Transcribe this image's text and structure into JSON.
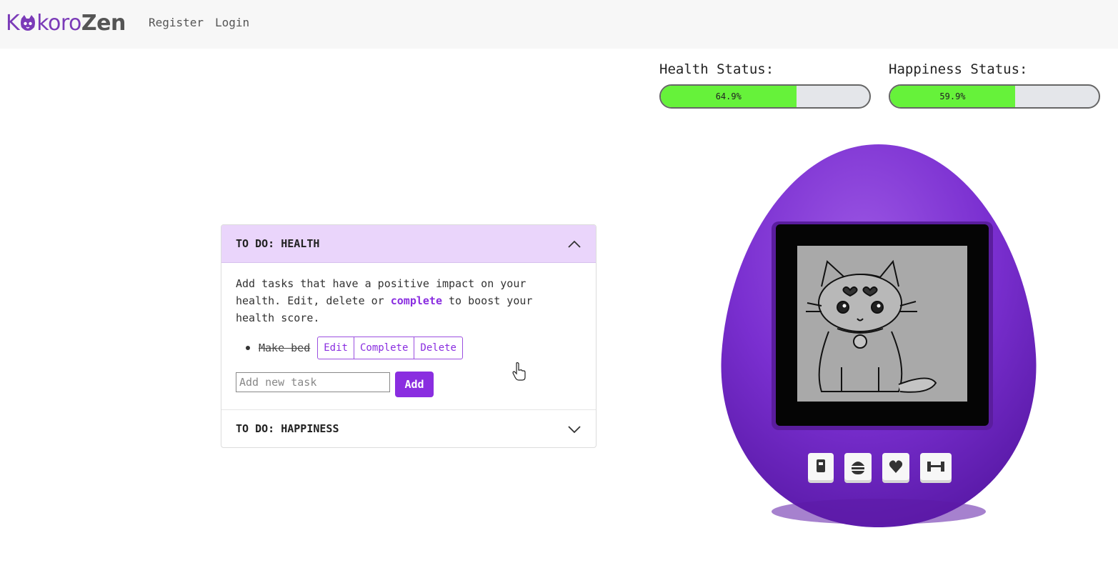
{
  "nav": {
    "logo_text_a": "K",
    "logo_text_b": "koro",
    "logo_text_c": "Zen",
    "register": "Register",
    "login": "Login"
  },
  "status": {
    "health_label": "Health Status:",
    "health_value": "64.9%",
    "health_fraction": 0.649,
    "happiness_label": "Happiness Status:",
    "happiness_value": "59.9%",
    "happiness_fraction": 0.599,
    "bar_color": "#66f23a"
  },
  "health_panel": {
    "title": "TO DO: HEALTH",
    "desc_a": "Add tasks that have a positive impact on your health. Edit, delete or ",
    "desc_highlight": "complete",
    "desc_b": " to boost your health score.",
    "tasks": [
      {
        "text": "Make bed",
        "completed": true,
        "edit": "Edit",
        "complete": "Complete",
        "delete": "Delete"
      }
    ],
    "input_placeholder": "Add new task",
    "add_label": "Add"
  },
  "happiness_panel": {
    "title": "TO DO: HAPPINESS"
  },
  "device": {
    "shell_color": "#7a2fd0",
    "buttons": [
      "food-icon",
      "burger-icon",
      "heart-icon",
      "dumbbell-icon"
    ]
  }
}
